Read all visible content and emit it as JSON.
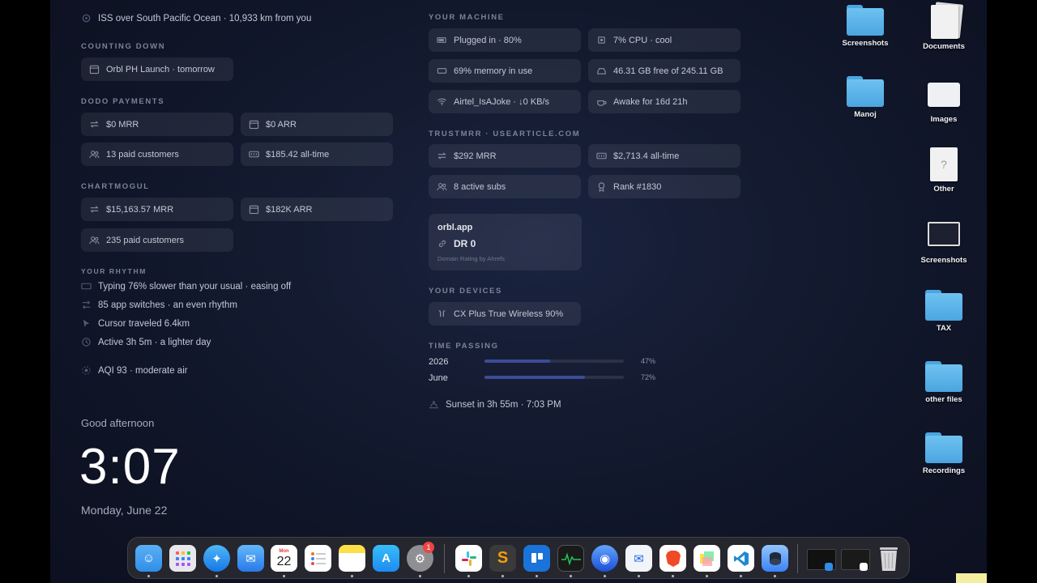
{
  "left": {
    "iss_text": "ISS over South Pacific Ocean · 10,933 km from you",
    "counting_down": {
      "label": "COUNTING DOWN",
      "event": "Orbl PH Launch · tomorrow"
    },
    "dodo": {
      "label": "DODO PAYMENTS",
      "mrr": "$0 MRR",
      "arr": "$0 ARR",
      "customers": "13 paid customers",
      "alltime": "$185.42 all-time"
    },
    "chartmogul": {
      "label": "CHARTMOGUL",
      "mrr": "$15,163.57 MRR",
      "arr": "$182K ARR",
      "customers": "235 paid customers"
    },
    "rhythm": {
      "label": "YOUR RHYTHM",
      "items": [
        "Typing 76% slower than your usual · easing off",
        "85 app switches · an even rhythm",
        "Cursor traveled 6.4km",
        "Active 3h 5m · a lighter day"
      ],
      "aqi": "AQI 93 · moderate air"
    },
    "clock": {
      "greeting": "Good afternoon",
      "time": "3:07",
      "date": "Monday, June 22"
    }
  },
  "machine": {
    "label": "YOUR MACHINE",
    "battery": "Plugged in · 80%",
    "cpu": "7% CPU · cool",
    "memory": "69% memory in use",
    "disk": "46.31 GB free of 245.11 GB",
    "wifi": "Airtel_IsAJoke · ↓0 KB/s",
    "uptime": "Awake for 16d 21h"
  },
  "trustmrr": {
    "label": "TRUSTMRR · USEARTICLE.COM",
    "mrr": "$292 MRR",
    "alltime": "$2,713.4 all-time",
    "subs": "8 active subs",
    "rank": "Rank #1830"
  },
  "orbl": {
    "domain": "orbl.app",
    "dr": "DR 0",
    "caption": "Domain Rating by Ahrefs"
  },
  "devices": {
    "label": "YOUR DEVICES",
    "item": "CX Plus True Wireless 90%"
  },
  "time_passing": {
    "label": "TIME PASSING",
    "rows": [
      {
        "name": "2026",
        "pct_text": "47%",
        "value": 0.47
      },
      {
        "name": "June",
        "pct_text": "72%",
        "value": 0.72
      }
    ],
    "sunset": "Sunset in 3h 55m · 7:03 PM"
  },
  "desktop_icons": [
    {
      "label": "Screenshots",
      "icon": "folder-icon"
    },
    {
      "label": "Documents",
      "icon": "documents-icon"
    },
    {
      "label": "Manoj",
      "icon": "folder-icon"
    },
    {
      "label": "Images",
      "icon": "images-icon"
    },
    {
      "label": "Other",
      "icon": "document-icon"
    },
    {
      "label": "Screenshots",
      "icon": "screenshot-thumbnail-icon"
    },
    {
      "label": "TAX",
      "icon": "folder-icon"
    },
    {
      "label": "other files",
      "icon": "folder-icon"
    },
    {
      "label": "Recordings",
      "icon": "folder-icon"
    }
  ],
  "dock": {
    "calendar_month": "Mon",
    "calendar_day": "22",
    "settings_badge": "1",
    "colors": {
      "finder": "#2f8ee8",
      "appstore": "#1c8cf2",
      "trello": "#1a73d9",
      "brave": "#f04a26",
      "vscode": "#1f8ad2"
    }
  }
}
